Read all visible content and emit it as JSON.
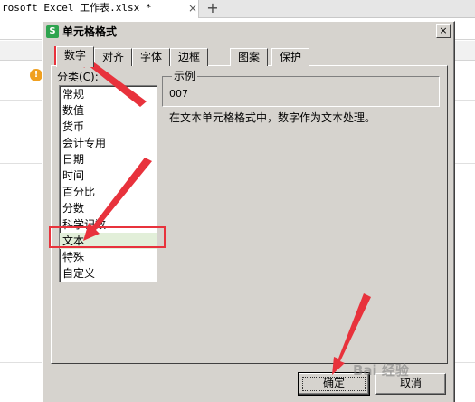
{
  "background": {
    "tab_title": "rosoft Excel 工作表.xlsx *",
    "tab_close": "×",
    "tab_add": "+",
    "warning_badge": "!"
  },
  "dialog": {
    "icon_letter": "S",
    "title": "单元格格式",
    "close_label": "×",
    "tabs": [
      {
        "label": "数字",
        "active": true
      },
      {
        "label": "对齐",
        "active": false
      },
      {
        "label": "字体",
        "active": false
      },
      {
        "label": "边框",
        "active": false
      },
      {
        "label": "图案",
        "active": false
      },
      {
        "label": "保护",
        "active": false
      }
    ],
    "category_label": "分类(C):",
    "categories": [
      "常规",
      "数值",
      "货币",
      "会计专用",
      "日期",
      "时间",
      "百分比",
      "分数",
      "科学记数",
      "文本",
      "特殊",
      "自定义"
    ],
    "selected_category": "文本",
    "sample_legend": "示例",
    "sample_value": "007",
    "description": "在文本单元格格式中，数字作为文本处理。",
    "ok_label": "确定",
    "cancel_label": "取消"
  },
  "colors": {
    "annotation_red": "#e8323c",
    "dialog_face": "#d6d3ce",
    "selection": "#e2efd9"
  },
  "watermark": "Bai 经验"
}
